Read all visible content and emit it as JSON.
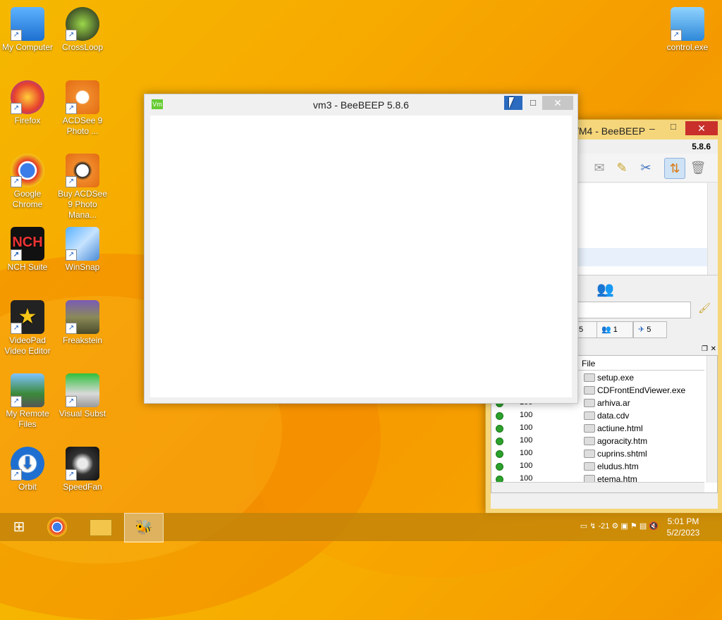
{
  "desktop": {
    "icons": [
      {
        "label": "My Computer",
        "icon": "computer-icon"
      },
      {
        "label": "CrossLoop",
        "icon": "crossloop-icon"
      },
      {
        "label": "Firefox",
        "icon": "firefox-icon"
      },
      {
        "label": "ACDSee 9 Photo ...",
        "icon": "acdsee-icon"
      },
      {
        "label": "Google Chrome",
        "icon": "chrome-icon"
      },
      {
        "label": "Buy ACDSee 9 Photo Mana...",
        "icon": "acdsee-buy-icon"
      },
      {
        "label": "NCH Suite",
        "icon": "nch-icon"
      },
      {
        "label": "WinSnap",
        "icon": "winsnap-icon"
      },
      {
        "label": "VideoPad Video Editor",
        "icon": "videopad-icon"
      },
      {
        "label": "Freakstein",
        "icon": "freakstein-icon"
      },
      {
        "label": "My Remote Files",
        "icon": "remote-files-icon"
      },
      {
        "label": "Visual Subst",
        "icon": "visual-subst-icon"
      },
      {
        "label": "Orbit",
        "icon": "orbit-icon"
      },
      {
        "label": "SpeedFan",
        "icon": "speedfan-icon"
      },
      {
        "label": "control.exe",
        "icon": "control-panel-icon"
      }
    ]
  },
  "vm3_window": {
    "icon_text": "Vm",
    "title": "vm3 - BeeBEEP 5.8.6",
    "min": "",
    "max": "□",
    "close": "✕"
  },
  "vm4_window": {
    "title": "/M4 - BeeBEEP",
    "min": "–",
    "max": "□",
    "close": "✕",
    "version": "5.8.6",
    "tab_counts": [
      "5",
      "1",
      "5"
    ],
    "file_header": "File",
    "files": [
      {
        "progress": "",
        "name": "setup.exe"
      },
      {
        "progress": "",
        "name": "CDFrontEndViewer.exe"
      },
      {
        "progress": "100",
        "name": "arhiva.ar"
      },
      {
        "progress": "100",
        "name": "data.cdv"
      },
      {
        "progress": "100",
        "name": "actiune.html"
      },
      {
        "progress": "100",
        "name": "agoracity.htm"
      },
      {
        "progress": "100",
        "name": "cuprins.shtml"
      },
      {
        "progress": "100",
        "name": "eludus.htm"
      },
      {
        "progress": "100",
        "name": "etema.htm"
      }
    ]
  },
  "taskbar": {
    "tray_temp": "-21",
    "time": "5:01 PM",
    "date": "5/2/2023"
  },
  "colors": {
    "desktop": "#f5a800",
    "vm4_frame": "#f6d67a",
    "close_red": "#c9302c",
    "min_blue": "#2b6bc0"
  }
}
